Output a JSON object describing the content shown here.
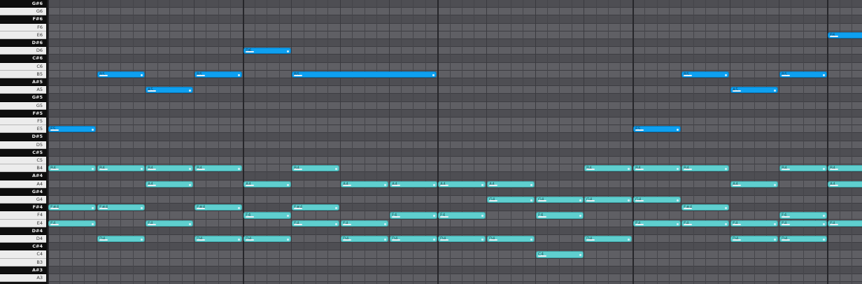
{
  "keyboard": {
    "keys": [
      {
        "label": "G#6",
        "black": true
      },
      {
        "label": "G6",
        "black": false
      },
      {
        "label": "F#6",
        "black": true
      },
      {
        "label": "F6",
        "black": false
      },
      {
        "label": "E6",
        "black": false
      },
      {
        "label": "D#6",
        "black": true
      },
      {
        "label": "D6",
        "black": false
      },
      {
        "label": "C#6",
        "black": true
      },
      {
        "label": "C6",
        "black": false
      },
      {
        "label": "B5",
        "black": false
      },
      {
        "label": "A#5",
        "black": true
      },
      {
        "label": "A5",
        "black": false
      },
      {
        "label": "G#5",
        "black": true
      },
      {
        "label": "G5",
        "black": false
      },
      {
        "label": "F#5",
        "black": true
      },
      {
        "label": "F5",
        "black": false
      },
      {
        "label": "E5",
        "black": false
      },
      {
        "label": "D#5",
        "black": true
      },
      {
        "label": "D5",
        "black": false
      },
      {
        "label": "C#5",
        "black": true
      },
      {
        "label": "C5",
        "black": false
      },
      {
        "label": "B4",
        "black": false
      },
      {
        "label": "A#4",
        "black": true
      },
      {
        "label": "A4",
        "black": false
      },
      {
        "label": "G#4",
        "black": true
      },
      {
        "label": "G4",
        "black": false
      },
      {
        "label": "F#4",
        "black": true
      },
      {
        "label": "F4",
        "black": false
      },
      {
        "label": "E4",
        "black": false
      },
      {
        "label": "D#4",
        "black": true
      },
      {
        "label": "D4",
        "black": false
      },
      {
        "label": "C#4",
        "black": true
      },
      {
        "label": "C4",
        "black": false
      },
      {
        "label": "B3",
        "black": false
      },
      {
        "label": "A#3",
        "black": true
      },
      {
        "label": "A3",
        "black": false
      }
    ]
  },
  "colors": {
    "melody": "#0ea0f0",
    "accompaniment": "#5fcfcf"
  },
  "notes": [
    {
      "pitch": "E5",
      "start": 0,
      "len": 1,
      "kind": "mel"
    },
    {
      "pitch": "B5",
      "start": 1,
      "len": 1,
      "kind": "mel"
    },
    {
      "pitch": "A5",
      "start": 2,
      "len": 1,
      "kind": "mel"
    },
    {
      "pitch": "B5",
      "start": 3,
      "len": 1,
      "kind": "mel"
    },
    {
      "pitch": "D6",
      "start": 4,
      "len": 1,
      "kind": "mel"
    },
    {
      "pitch": "B5",
      "start": 5,
      "len": 3,
      "kind": "mel"
    },
    {
      "pitch": "E5",
      "start": 12,
      "len": 1,
      "kind": "mel"
    },
    {
      "pitch": "B5",
      "start": 13,
      "len": 1,
      "kind": "mel"
    },
    {
      "pitch": "A5",
      "start": 14,
      "len": 1,
      "kind": "mel"
    },
    {
      "pitch": "B5",
      "start": 15,
      "len": 1,
      "kind": "mel"
    },
    {
      "pitch": "E6",
      "start": 16,
      "len": 1,
      "kind": "mel"
    },
    {
      "pitch": "B4",
      "start": 0,
      "len": 1,
      "kind": "acc"
    },
    {
      "pitch": "B4",
      "start": 1,
      "len": 1,
      "kind": "acc"
    },
    {
      "pitch": "B4",
      "start": 2,
      "len": 1,
      "kind": "acc"
    },
    {
      "pitch": "B4",
      "start": 3,
      "len": 1,
      "kind": "acc"
    },
    {
      "pitch": "B4",
      "start": 5,
      "len": 1,
      "kind": "acc"
    },
    {
      "pitch": "B4",
      "start": 11,
      "len": 1,
      "kind": "acc"
    },
    {
      "pitch": "B4",
      "start": 12,
      "len": 1,
      "kind": "acc"
    },
    {
      "pitch": "B4",
      "start": 13,
      "len": 1,
      "kind": "acc"
    },
    {
      "pitch": "B4",
      "start": 15,
      "len": 1,
      "kind": "acc"
    },
    {
      "pitch": "B4",
      "start": 16,
      "len": 1,
      "kind": "acc"
    },
    {
      "pitch": "A4",
      "start": 2,
      "len": 1,
      "kind": "acc"
    },
    {
      "pitch": "A4",
      "start": 4,
      "len": 1,
      "kind": "acc"
    },
    {
      "pitch": "A4",
      "start": 6,
      "len": 1,
      "kind": "acc"
    },
    {
      "pitch": "A4",
      "start": 7,
      "len": 1,
      "kind": "acc"
    },
    {
      "pitch": "A4",
      "start": 8,
      "len": 1,
      "kind": "acc"
    },
    {
      "pitch": "A4",
      "start": 9,
      "len": 1,
      "kind": "acc"
    },
    {
      "pitch": "A4",
      "start": 14,
      "len": 1,
      "kind": "acc"
    },
    {
      "pitch": "A4",
      "start": 16,
      "len": 1,
      "kind": "acc"
    },
    {
      "pitch": "G4",
      "start": 9,
      "len": 1,
      "kind": "acc"
    },
    {
      "pitch": "G4",
      "start": 10,
      "len": 1,
      "kind": "acc"
    },
    {
      "pitch": "G4",
      "start": 11,
      "len": 1,
      "kind": "acc"
    },
    {
      "pitch": "G4",
      "start": 12,
      "len": 1,
      "kind": "acc"
    },
    {
      "pitch": "F#4",
      "start": 0,
      "len": 1,
      "kind": "acc"
    },
    {
      "pitch": "F#4",
      "start": 1,
      "len": 1,
      "kind": "acc"
    },
    {
      "pitch": "F#4",
      "start": 3,
      "len": 1,
      "kind": "acc"
    },
    {
      "pitch": "F#4",
      "start": 5,
      "len": 1,
      "kind": "acc"
    },
    {
      "pitch": "F#4",
      "start": 13,
      "len": 1,
      "kind": "acc"
    },
    {
      "pitch": "F4",
      "start": 4,
      "len": 1,
      "kind": "acc"
    },
    {
      "pitch": "F4",
      "start": 7,
      "len": 1,
      "kind": "acc"
    },
    {
      "pitch": "F4",
      "start": 8,
      "len": 1,
      "kind": "acc"
    },
    {
      "pitch": "F4",
      "start": 10,
      "len": 1,
      "kind": "acc"
    },
    {
      "pitch": "F4",
      "start": 15,
      "len": 1,
      "kind": "acc"
    },
    {
      "pitch": "E4",
      "start": 0,
      "len": 1,
      "kind": "acc"
    },
    {
      "pitch": "E4",
      "start": 2,
      "len": 1,
      "kind": "acc"
    },
    {
      "pitch": "E4",
      "start": 5,
      "len": 1,
      "kind": "acc"
    },
    {
      "pitch": "E4",
      "start": 6,
      "len": 1,
      "kind": "acc"
    },
    {
      "pitch": "E4",
      "start": 12,
      "len": 1,
      "kind": "acc"
    },
    {
      "pitch": "E4",
      "start": 13,
      "len": 1,
      "kind": "acc"
    },
    {
      "pitch": "E4",
      "start": 14,
      "len": 1,
      "kind": "acc"
    },
    {
      "pitch": "E4",
      "start": 15,
      "len": 1,
      "kind": "acc"
    },
    {
      "pitch": "E4",
      "start": 16,
      "len": 1,
      "kind": "acc"
    },
    {
      "pitch": "D4",
      "start": 1,
      "len": 1,
      "kind": "acc"
    },
    {
      "pitch": "D4",
      "start": 3,
      "len": 1,
      "kind": "acc"
    },
    {
      "pitch": "D4",
      "start": 4,
      "len": 1,
      "kind": "acc"
    },
    {
      "pitch": "D4",
      "start": 6,
      "len": 1,
      "kind": "acc"
    },
    {
      "pitch": "D4",
      "start": 7,
      "len": 1,
      "kind": "acc"
    },
    {
      "pitch": "D4",
      "start": 8,
      "len": 1,
      "kind": "acc"
    },
    {
      "pitch": "D4",
      "start": 9,
      "len": 1,
      "kind": "acc"
    },
    {
      "pitch": "D4",
      "start": 11,
      "len": 1,
      "kind": "acc"
    },
    {
      "pitch": "D4",
      "start": 14,
      "len": 1,
      "kind": "acc"
    },
    {
      "pitch": "D4",
      "start": 15,
      "len": 1,
      "kind": "acc"
    },
    {
      "pitch": "C4",
      "start": 10,
      "len": 1,
      "kind": "acc"
    }
  ]
}
